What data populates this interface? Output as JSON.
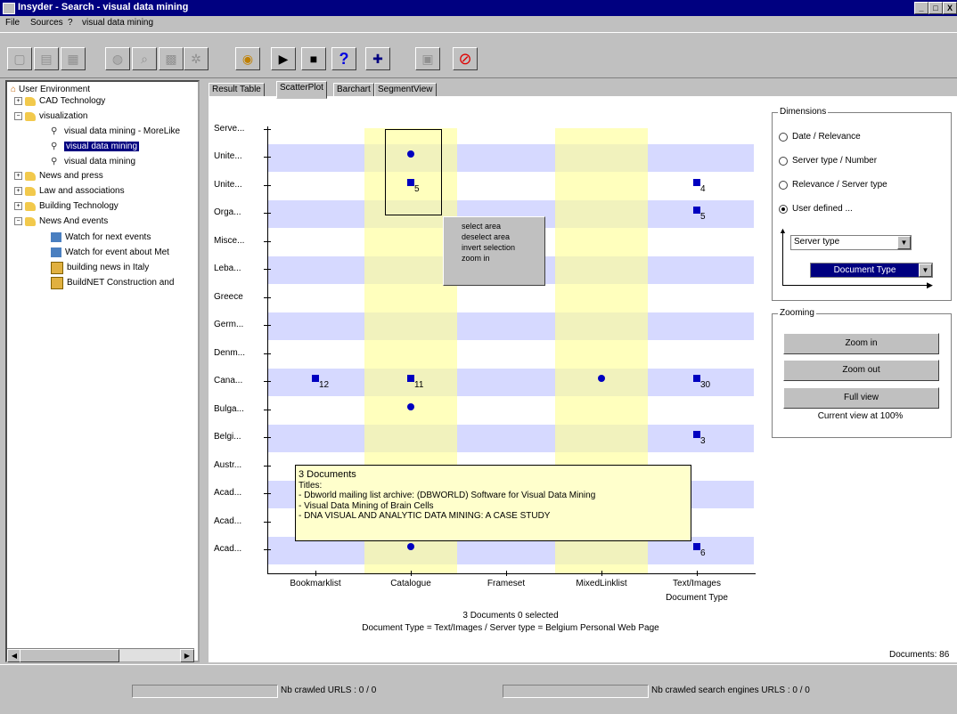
{
  "window": {
    "title": "Insyder - Search - visual data mining",
    "buttons": [
      "_",
      "□",
      "X"
    ]
  },
  "menu": {
    "items": [
      "File",
      "Sources",
      "?",
      "visual data mining"
    ]
  },
  "tree": {
    "nodes": [
      {
        "label": "User Environment",
        "icon": "home-icon"
      },
      {
        "label": "CAD Technology",
        "icon": "folder-icon"
      },
      {
        "label": "visualization",
        "icon": "folder-icon"
      },
      {
        "label": "visual data mining - MoreLike",
        "icon": "search-icon"
      },
      {
        "label": "visual data mining",
        "icon": "search-icon",
        "selected": true
      },
      {
        "label": "visual data mining",
        "icon": "search-icon"
      },
      {
        "label": "News and press",
        "icon": "folder-icon"
      },
      {
        "label": "Law and associations",
        "icon": "folder-icon"
      },
      {
        "label": "Building Technology",
        "icon": "folder-icon"
      },
      {
        "label": "News And events",
        "icon": "folder-icon"
      },
      {
        "label": "Watch for next events",
        "icon": "watch-icon"
      },
      {
        "label": "Watch for event about Met",
        "icon": "watch-icon"
      },
      {
        "label": "building news in Italy",
        "icon": "bookmark-icon"
      },
      {
        "label": "BuildNET Construction and",
        "icon": "bookmark-icon"
      }
    ]
  },
  "tabs": [
    "Result Table",
    "ScatterPlot",
    "Barchart",
    "SegmentView"
  ],
  "active_tab": "ScatterPlot",
  "chart_data": {
    "type": "scatter",
    "xlabel": "Document Type",
    "x_categories": [
      "Bookmarklist",
      "Catalogue",
      "Frameset",
      "MixedLinklist",
      "Text/Images"
    ],
    "y_categories": [
      "Acad...",
      "Acad...",
      "Acad...",
      "Austr...",
      "Belgi...",
      "Bulga...",
      "Cana...",
      "Denm...",
      "Germ...",
      "Greece",
      "Leba...",
      "Misce...",
      "Orga...",
      "Unite...",
      "Unite...",
      "Serve..."
    ],
    "points": [
      {
        "x": "Catalogue",
        "y_index": 0,
        "shape": "circle"
      },
      {
        "x": "Text/Images",
        "y_index": 0,
        "shape": "square",
        "label": "6"
      },
      {
        "x": "Text/Images",
        "y_index": 4,
        "shape": "square",
        "label": "3"
      },
      {
        "x": "Catalogue",
        "y_index": 5,
        "shape": "circle"
      },
      {
        "x": "Bookmarklist",
        "y_index": 6,
        "shape": "square",
        "label": "12"
      },
      {
        "x": "Catalogue",
        "y_index": 6,
        "shape": "square",
        "label": "11"
      },
      {
        "x": "MixedLinklist",
        "y_index": 6,
        "shape": "circle"
      },
      {
        "x": "Text/Images",
        "y_index": 6,
        "shape": "square",
        "label": "30"
      },
      {
        "x": "Text/Images",
        "y_index": 12,
        "shape": "square",
        "label": "5"
      },
      {
        "x": "Catalogue",
        "y_index": 13,
        "shape": "square",
        "label": "5"
      },
      {
        "x": "Text/Images",
        "y_index": 13,
        "shape": "square",
        "label": "4"
      },
      {
        "x": "Catalogue",
        "y_index": 14,
        "shape": "circle"
      }
    ]
  },
  "context_menu": [
    "select area",
    "deselect area",
    "invert selection",
    "zoom in"
  ],
  "tooltip": {
    "lines": [
      "3 Documents",
      "Titles:",
      "- Dbworld mailing list archive: (DBWORLD) Software for Visual Data Mining",
      "- Visual Data Mining of Brain Cells",
      "- DNA VISUAL AND ANALYTIC DATA MINING: A CASE STUDY"
    ]
  },
  "status": {
    "line1": "3 Documents 0 selected",
    "line2": "Document Type = Text/Images / Server type = Belgium Personal Web Page",
    "documents": "Documents: 86",
    "crawled_urls": "Nb crawled URLS : 0 / 0",
    "crawled_engines": "Nb crawled search engines URLS : 0 / 0"
  },
  "dimensions": {
    "title": "Dimensions",
    "options": [
      "Date / Relevance",
      "Server type / Number",
      "Relevance / Server type",
      "User defined ..."
    ],
    "selected_index": 3,
    "y_combo": "Server type",
    "x_combo": "Document Type"
  },
  "zooming": {
    "title": "Zooming",
    "zoom_in": "Zoom in",
    "zoom_out": "Zoom out",
    "full_view": "Full view",
    "current_view": "Current view at 100%"
  },
  "colors": {
    "titlebar": "#000080",
    "band_h": "#d6d9ff",
    "band_v": "#ffff99",
    "marker": "#0000c0",
    "tooltip": "#ffffcc"
  }
}
